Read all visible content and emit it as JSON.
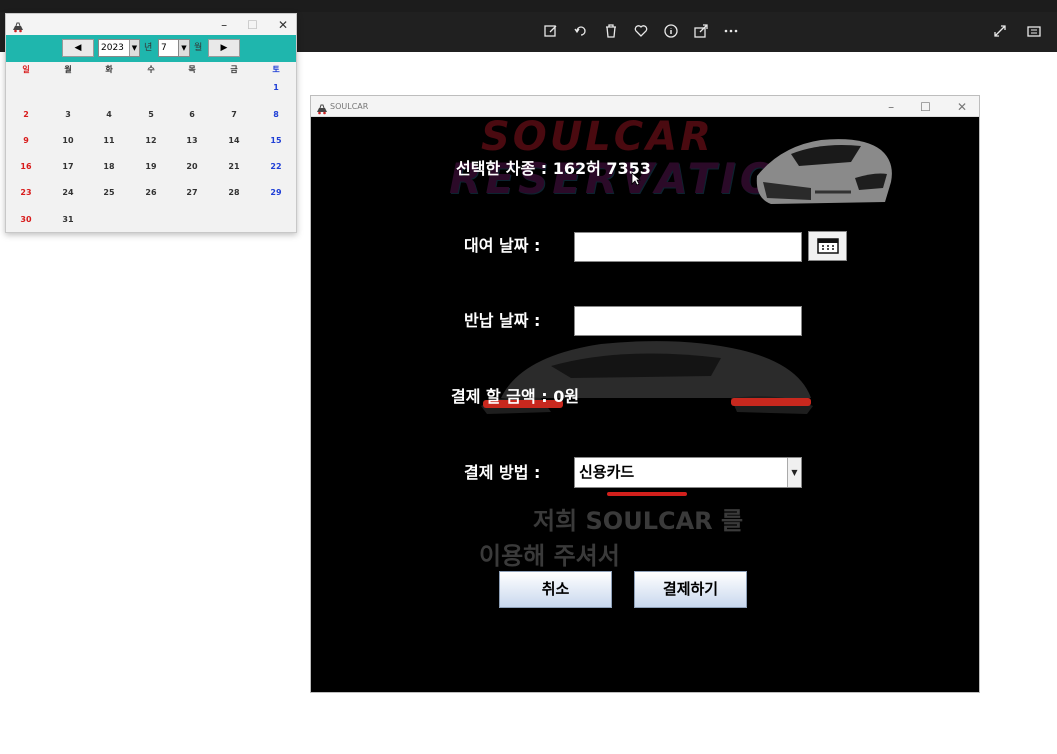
{
  "viewer": {
    "icons": [
      "edit-icon",
      "rotate-icon",
      "delete-icon",
      "heart-icon",
      "info-icon",
      "share-icon",
      "more-icon"
    ],
    "right_icons": [
      "expand-icon",
      "panel-icon"
    ]
  },
  "calendar": {
    "year": "2023",
    "year_suffix": "년",
    "month": "7",
    "month_suffix": "월",
    "prev": "◀",
    "next": "▶",
    "weekdays": [
      "일",
      "월",
      "화",
      "수",
      "목",
      "금",
      "토"
    ],
    "weeks": [
      [
        "",
        "",
        "",
        "",
        "",
        "",
        "1"
      ],
      [
        "2",
        "3",
        "4",
        "5",
        "6",
        "7",
        "8"
      ],
      [
        "9",
        "10",
        "11",
        "12",
        "13",
        "14",
        "15"
      ],
      [
        "16",
        "17",
        "18",
        "19",
        "20",
        "21",
        "22"
      ],
      [
        "23",
        "24",
        "25",
        "26",
        "27",
        "28",
        "29"
      ],
      [
        "30",
        "31",
        "",
        "",
        "",
        "",
        ""
      ]
    ],
    "controls": {
      "min": "–",
      "max": "☐",
      "close": "✕"
    }
  },
  "main": {
    "window_title": "SOULCAR",
    "controls": {
      "min": "–",
      "max": "☐",
      "close": "✕"
    },
    "watermark_line1": "SOULCAR",
    "watermark_line2": "RESERVATION",
    "selected_car": "선택한 차종 : 162허 7353",
    "rental_date_label": "대여 날짜 :",
    "return_date_label": "반납 날짜 :",
    "amount": "결제 할 금액 : 0원",
    "payment_label": "결제 방법 :",
    "payment_method": "신용카드",
    "slogan_line1": "저희 SOULCAR 를",
    "slogan_line2": "이용해 주셔서",
    "cancel_button": "취소",
    "pay_button": "결제하기"
  },
  "colors": {
    "calendar_header": "#1fb6ad",
    "main_bg": "#000000",
    "accent_red": "#d2201c"
  }
}
